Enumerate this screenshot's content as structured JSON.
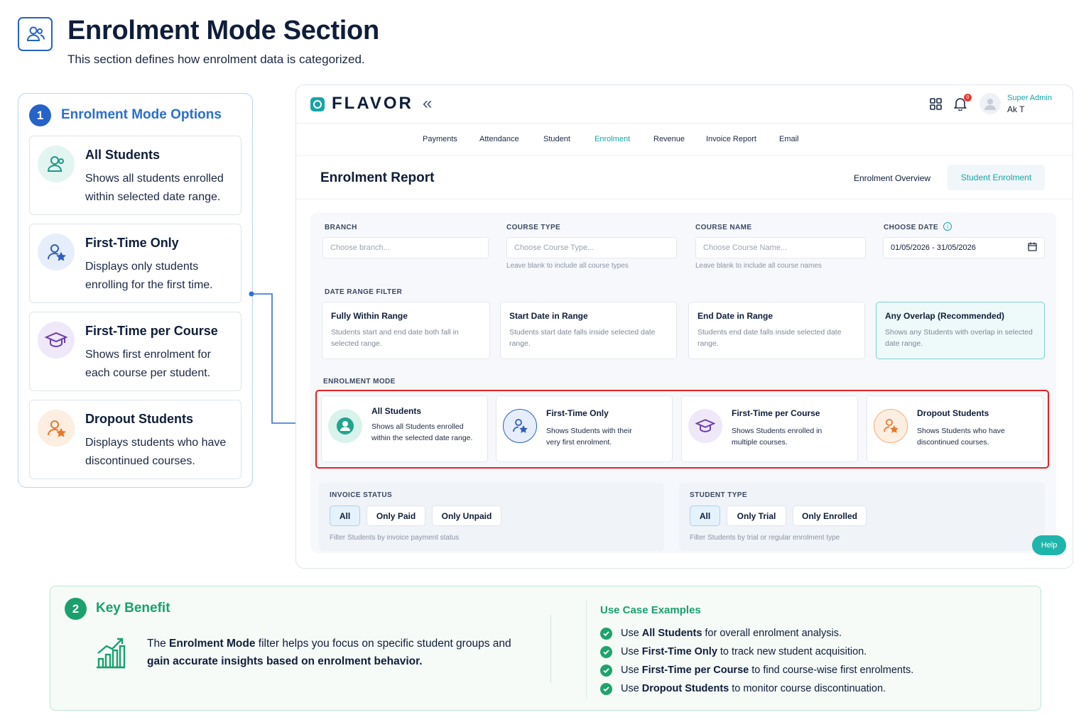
{
  "header": {
    "title": "Enrolment Mode Section",
    "subtitle": "This section defines how enrolment data is categorized."
  },
  "left_panel": {
    "number": "1",
    "heading": "Enrolment Mode Options",
    "options": [
      {
        "title": "All Students",
        "desc": "Shows all students enrolled within selected date range."
      },
      {
        "title": "First-Time Only",
        "desc": "Displays only students enrolling for the first time."
      },
      {
        "title": "First-Time per Course",
        "desc": "Shows first enrolment for each course per student."
      },
      {
        "title": "Dropout Students",
        "desc": "Displays students who have discontinued courses."
      }
    ]
  },
  "app": {
    "logo": "FLAVOR",
    "collapse_glyph": "«",
    "notification_count": "0",
    "user_role": "Super Admin",
    "user_name": "Ak T",
    "nav": [
      "Payments",
      "Attendance",
      "Student",
      "Enrolment",
      "Revenue",
      "Invoice Report",
      "Email"
    ],
    "nav_active": "Enrolment",
    "report_title": "Enrolment Report",
    "tabs": [
      "Enrolment Overview",
      "Student Enrolment"
    ],
    "filters": {
      "branch_label": "BRANCH",
      "branch_placeholder": "Choose branch...",
      "course_type_label": "COURSE TYPE",
      "course_type_placeholder": "Choose Course Type...",
      "course_type_hint": "Leave blank to include all course types",
      "course_name_label": "COURSE NAME",
      "course_name_placeholder": "Choose Course Name...",
      "course_name_hint": "Leave blank to include all course names",
      "date_label": "CHOOSE DATE",
      "date_value": "01/05/2026 - 31/05/2026"
    },
    "date_range_filter": {
      "label": "DATE RANGE FILTER",
      "options": [
        {
          "title": "Fully Within Range",
          "desc": "Students start and end date both fall in selected range."
        },
        {
          "title": "Start Date in Range",
          "desc": "Students start date falls inside selected date range."
        },
        {
          "title": "End Date in Range",
          "desc": "Students end date falls inside selected date range."
        },
        {
          "title": "Any Overlap (Recommended)",
          "desc": "Shows any Students with overlap in selected date range."
        }
      ],
      "selected": "Any Overlap (Recommended)"
    },
    "enrolment_mode": {
      "label": "ENROLMENT MODE",
      "options": [
        {
          "title": "All Students",
          "desc": "Shows all Students enrolled within the selected date range."
        },
        {
          "title": "First-Time Only",
          "desc": "Shows Students with their very first enrolment."
        },
        {
          "title": "First-Time per Course",
          "desc": "Shows Students enrolled in multiple courses."
        },
        {
          "title": "Dropout Students",
          "desc": "Shows Students who have discontinued courses."
        }
      ]
    },
    "invoice_status": {
      "label": "INVOICE STATUS",
      "options": [
        "All",
        "Only Paid",
        "Only Unpaid"
      ],
      "selected": "All",
      "hint": "Filter Students by invoice payment status"
    },
    "student_type": {
      "label": "STUDENT TYPE",
      "options": [
        "All",
        "Only Trial",
        "Only Enrolled"
      ],
      "selected": "All",
      "hint": "Filter Students by trial or regular enrolment type"
    },
    "help_label": "Help"
  },
  "benefit": {
    "number": "2",
    "heading": "Key Benefit",
    "text_pre": "The",
    "text_bold1": "Enrolment Mode",
    "text_mid": "filter helps you focus on specific student groups and",
    "text_bold2": "gain accurate insights based on enrolment behavior.",
    "use_case_heading": "Use Case Examples",
    "use_cases": [
      {
        "pre": "Use",
        "bold": "All Students",
        "post": "for overall enrolment analysis."
      },
      {
        "pre": "Use",
        "bold": "First-Time Only",
        "post": "to track new student acquisition."
      },
      {
        "pre": "Use",
        "bold": "First-Time per Course",
        "post": "to find course-wise first enrolments."
      },
      {
        "pre": "Use",
        "bold": "Dropout Students",
        "post": "to monitor course discontinuation."
      }
    ]
  },
  "colors": {
    "accent_blue": "#2563c9",
    "teal": "#17a5a5",
    "green": "#19a06d",
    "highlight_red": "#e02424"
  }
}
